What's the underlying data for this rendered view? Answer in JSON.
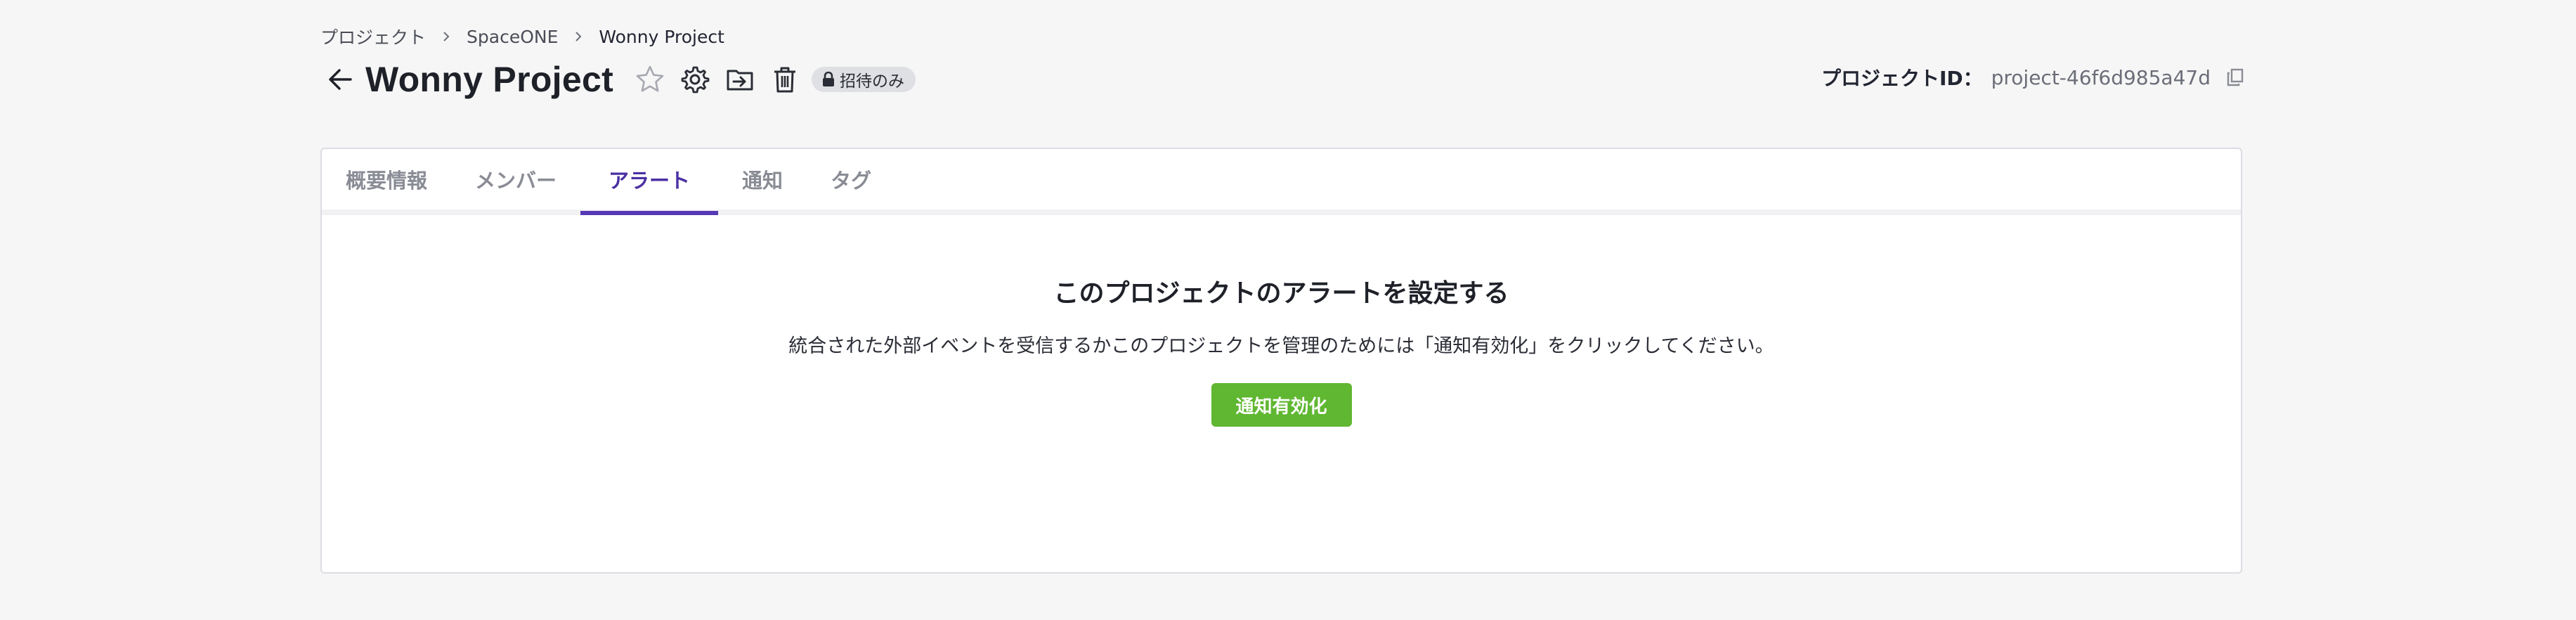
{
  "breadcrumb": {
    "items": [
      {
        "label": "プロジェクト"
      },
      {
        "label": "SpaceONE"
      },
      {
        "label": "Wonny Project"
      }
    ]
  },
  "header": {
    "title": "Wonny Project",
    "back_icon": "arrow-left-icon",
    "favorite_icon": "star-outline-icon",
    "settings_icon": "gear-icon",
    "move_icon": "folder-move-icon",
    "delete_icon": "trash-icon",
    "badge": {
      "icon": "lock-icon",
      "label": "招待のみ"
    }
  },
  "project_id": {
    "label": "プロジェクトID：",
    "value": "project-46f6d985a47d",
    "copy_icon": "copy-icon"
  },
  "tabs": [
    {
      "label": "概要情報",
      "active": false
    },
    {
      "label": "メンバー",
      "active": false
    },
    {
      "label": "アラート",
      "active": true
    },
    {
      "label": "通知",
      "active": false
    },
    {
      "label": "タグ",
      "active": false
    }
  ],
  "alert": {
    "title": "このプロジェクトのアラートを設定する",
    "description": "統合された外部イベントを受信するかこのプロジェクトを管理のためには「通知有効化」をクリックしてください。",
    "button_label": "通知有効化"
  },
  "colors": {
    "accent": "#5638b4",
    "button": "#60b731",
    "background": "#f6f6f6"
  }
}
